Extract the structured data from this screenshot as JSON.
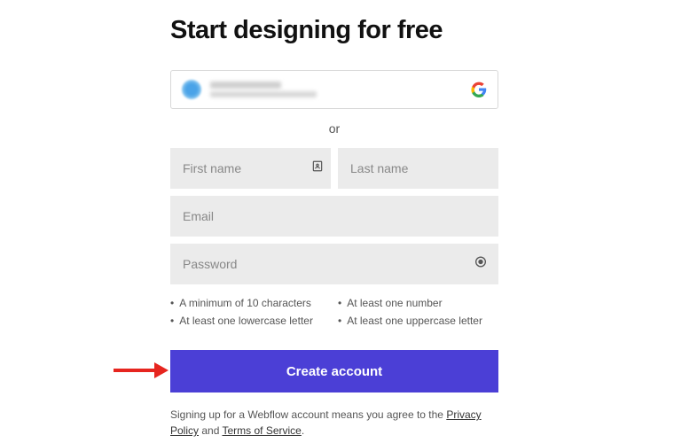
{
  "title": "Start designing for free",
  "divider": "or",
  "fields": {
    "first_name_placeholder": "First name",
    "last_name_placeholder": "Last name",
    "email_placeholder": "Email",
    "password_placeholder": "Password"
  },
  "password_requirements": [
    "A minimum of 10 characters",
    "At least one number",
    "At least one lowercase letter",
    "At least one uppercase letter"
  ],
  "create_button": "Create account",
  "legal": {
    "prefix": "Signing up for a Webflow account means you agree to the ",
    "privacy": "Privacy Policy",
    "and": " and ",
    "tos": "Terms of Service",
    "suffix": "."
  },
  "colors": {
    "primary_button": "#4b3fd6",
    "field_bg": "#ebebeb",
    "arrow": "#e6251f"
  }
}
